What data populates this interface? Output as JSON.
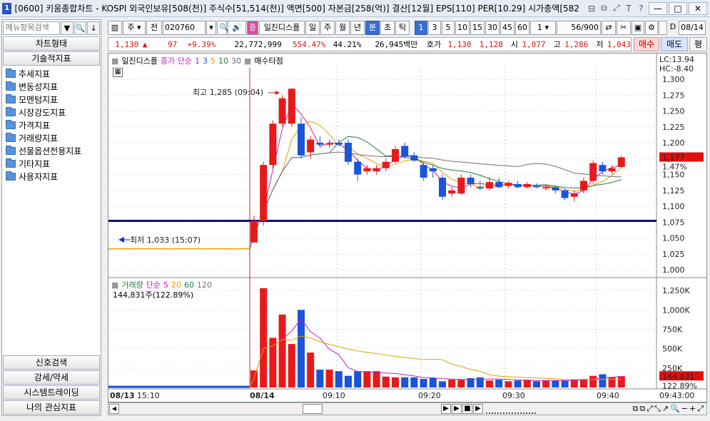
{
  "window": {
    "title": "[0600] 키움종합차트 - KOSPI 외국인보유[508(천)] 주식수[51,514(천)] 액면[500] 자본금[258(억)] 결산[12월] EPS[110] PER[10.29] 시가총액[582",
    "app_icon": "1",
    "controls": [
      "—",
      "□",
      "✕"
    ],
    "title_tools": [
      "⊟",
      "⧉",
      "⤢",
      "T",
      "?"
    ]
  },
  "left_panel": {
    "search_placeholder": "메뉴항목검색",
    "header": "차트형태",
    "subheader": "기술적지표",
    "items": [
      "추세지표",
      "변동성지표",
      "모멘텀지표",
      "시장강도지표",
      "가격지표",
      "거래량지표",
      "선물옵션전용지표",
      "기타지표",
      "사용자지표"
    ],
    "bottom_buttons": [
      "신호검색",
      "강세/약세",
      "시스템트레이딩",
      "나의 관심지표"
    ]
  },
  "toolbar": {
    "period_select": "주",
    "market_btn": "전",
    "code": "020760",
    "chart_type_label": "일진디스플",
    "period_buttons": [
      "일",
      "주",
      "월",
      "년",
      "분",
      "초",
      "틱"
    ],
    "selected_period": "분",
    "interval_buttons": [
      "1",
      "3",
      "5",
      "10",
      "15",
      "30",
      "45",
      "60"
    ],
    "selected_interval": "1",
    "count_select": "1",
    "count_display": "56/900",
    "date": "08/14",
    "badge": "증"
  },
  "quote": {
    "price": "1,130",
    "arrow": "▲",
    "change": "97",
    "change_pct": "+9.39%",
    "volume": "22,772,999",
    "vol_ratio": "554.47%",
    "turnover_rate": "44.21%",
    "amount": "26,945백만",
    "ask_label": "호가",
    "ask1": "1,130",
    "ask2": "1,128",
    "open_label": "시",
    "open": "1,077",
    "high_label": "고",
    "high": "1,286",
    "low_label": "저",
    "low": "1,043",
    "buy": "매수",
    "sell": "매도",
    "flat": "평"
  },
  "price_legend": {
    "name": "일진디스플",
    "ma_label": "종가 단순",
    "periods": [
      "1",
      "3",
      "5",
      "10",
      "30"
    ],
    "signal": "매수타점"
  },
  "annotations": {
    "high_note": "최고 1,285 (09:04)",
    "low_note": "최저 1,033 (15:07)",
    "lc": "LC:13.94",
    "hc": "HC:-8.40",
    "cur_price": "1,177",
    "cur_pct": "1.47%",
    "cur_vol": "144,831",
    "cur_vol_pct": "122.89%"
  },
  "volume_legend": {
    "name": "거래량",
    "ma_label": "단순",
    "periods": [
      "5",
      "20",
      "60",
      "120"
    ],
    "value_text": "144,831주(122.89%)"
  },
  "x_labels": [
    "08/13",
    "15:10",
    "08/14",
    "09:10",
    "09:20",
    "09:30",
    "09:40",
    "09:43:00"
  ],
  "colors": {
    "up": "#e8191a",
    "down": "#1a54d8",
    "ma_purple": "#c020c0",
    "ma_orange": "#e8a000",
    "ma_green": "#208040",
    "ma_gray": "#707070",
    "hline": "#101070"
  },
  "chart_data": [
    {
      "type": "candlestick",
      "title": "",
      "y_ticks": [
        1000,
        1025,
        1050,
        1075,
        1100,
        1125,
        1150,
        1175,
        1200,
        1225,
        1250,
        1275,
        1300
      ],
      "ylim": [
        990,
        1318
      ],
      "horizontal_line": 1077,
      "bars": [
        {
          "o": 1033,
          "h": 1033,
          "l": 1033,
          "c": 1033
        },
        {
          "o": 1043,
          "h": 1085,
          "l": 1043,
          "c": 1077
        },
        {
          "o": 1077,
          "h": 1170,
          "l": 1070,
          "c": 1165
        },
        {
          "o": 1165,
          "h": 1235,
          "l": 1160,
          "c": 1230
        },
        {
          "o": 1230,
          "h": 1275,
          "l": 1225,
          "c": 1270
        },
        {
          "o": 1230,
          "h": 1286,
          "l": 1225,
          "c": 1285
        },
        {
          "o": 1230,
          "h": 1240,
          "l": 1175,
          "c": 1180
        },
        {
          "o": 1185,
          "h": 1210,
          "l": 1175,
          "c": 1205
        },
        {
          "o": 1200,
          "h": 1210,
          "l": 1195,
          "c": 1197
        },
        {
          "o": 1197,
          "h": 1205,
          "l": 1192,
          "c": 1199
        },
        {
          "o": 1200,
          "h": 1205,
          "l": 1195,
          "c": 1197
        },
        {
          "o": 1200,
          "h": 1205,
          "l": 1165,
          "c": 1170
        },
        {
          "o": 1170,
          "h": 1175,
          "l": 1140,
          "c": 1150
        },
        {
          "o": 1155,
          "h": 1165,
          "l": 1150,
          "c": 1160
        },
        {
          "o": 1155,
          "h": 1165,
          "l": 1150,
          "c": 1160
        },
        {
          "o": 1160,
          "h": 1175,
          "l": 1155,
          "c": 1170
        },
        {
          "o": 1170,
          "h": 1195,
          "l": 1168,
          "c": 1190
        },
        {
          "o": 1195,
          "h": 1200,
          "l": 1175,
          "c": 1178
        },
        {
          "o": 1180,
          "h": 1185,
          "l": 1170,
          "c": 1172
        },
        {
          "o": 1165,
          "h": 1170,
          "l": 1140,
          "c": 1145
        },
        {
          "o": 1160,
          "h": 1165,
          "l": 1145,
          "c": 1155
        },
        {
          "o": 1145,
          "h": 1150,
          "l": 1110,
          "c": 1115
        },
        {
          "o": 1120,
          "h": 1130,
          "l": 1115,
          "c": 1125
        },
        {
          "o": 1120,
          "h": 1150,
          "l": 1118,
          "c": 1145
        },
        {
          "o": 1145,
          "h": 1150,
          "l": 1130,
          "c": 1135
        },
        {
          "o": 1130,
          "h": 1140,
          "l": 1125,
          "c": 1128
        },
        {
          "o": 1128,
          "h": 1145,
          "l": 1125,
          "c": 1138
        },
        {
          "o": 1138,
          "h": 1145,
          "l": 1128,
          "c": 1130
        },
        {
          "o": 1132,
          "h": 1140,
          "l": 1128,
          "c": 1137
        },
        {
          "o": 1135,
          "h": 1140,
          "l": 1128,
          "c": 1130
        },
        {
          "o": 1130,
          "h": 1138,
          "l": 1128,
          "c": 1135
        },
        {
          "o": 1132,
          "h": 1136,
          "l": 1128,
          "c": 1130
        },
        {
          "o": 1128,
          "h": 1135,
          "l": 1125,
          "c": 1130
        },
        {
          "o": 1130,
          "h": 1132,
          "l": 1120,
          "c": 1125
        },
        {
          "o": 1125,
          "h": 1128,
          "l": 1110,
          "c": 1113
        },
        {
          "o": 1115,
          "h": 1125,
          "l": 1108,
          "c": 1120
        },
        {
          "o": 1125,
          "h": 1145,
          "l": 1120,
          "c": 1140
        },
        {
          "o": 1140,
          "h": 1172,
          "l": 1135,
          "c": 1168
        },
        {
          "o": 1165,
          "h": 1170,
          "l": 1150,
          "c": 1155
        },
        {
          "o": 1155,
          "h": 1165,
          "l": 1150,
          "c": 1160
        },
        {
          "o": 1162,
          "h": 1180,
          "l": 1160,
          "c": 1177
        }
      ]
    },
    {
      "type": "bar",
      "title": "",
      "y_ticks": [
        0,
        250000,
        500000,
        750000,
        1000000,
        1250000
      ],
      "y_tick_labels": [
        "",
        "250K",
        "500K",
        "750K",
        "1,000K",
        "1,250K"
      ],
      "ylim": [
        0,
        1380000
      ],
      "values": [
        8000,
        220000,
        1280000,
        640000,
        940000,
        560000,
        1000000,
        450000,
        230000,
        230000,
        210000,
        150000,
        210000,
        210000,
        210000,
        140000,
        130000,
        130000,
        130000,
        110000,
        120000,
        80000,
        100000,
        100000,
        120000,
        130000,
        90000,
        100000,
        80000,
        90000,
        100000,
        80000,
        90000,
        90000,
        90000,
        100000,
        110000,
        150000,
        170000,
        130000,
        145000
      ]
    }
  ]
}
